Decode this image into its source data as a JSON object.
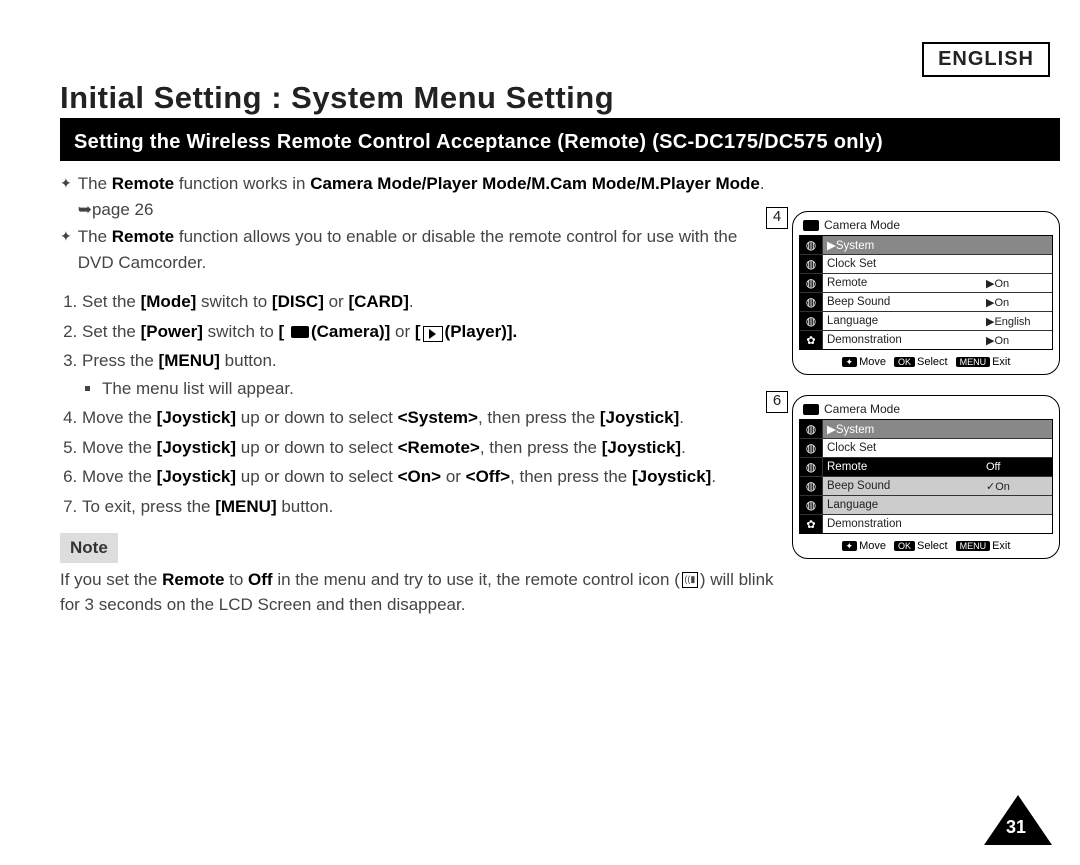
{
  "lang_label": "ENGLISH",
  "main_title": "Initial Setting : System Menu Setting",
  "section_title": "Setting the Wireless Remote Control Acceptance (Remote) (SC-DC175/DC575 only)",
  "bullet1_pre": "The ",
  "bullet1_b1": "Remote",
  "bullet1_mid": " function works in ",
  "bullet1_b2": "Camera Mode/Player Mode/M.Cam Mode/M.Player Mode",
  "bullet1_post": ". ➥page 26",
  "bullet2_pre": "The ",
  "bullet2_b1": "Remote",
  "bullet2_post": " function allows you to enable or disable the remote control for use with the DVD Camcorder.",
  "steps": [
    {
      "pre": "Set the ",
      "b1": "[Mode]",
      "mid": " switch to ",
      "b2": "[DISC]",
      "mid2": " or ",
      "b3": "[CARD]",
      "post": "."
    },
    {
      "pre": "Set the ",
      "b1": "[Power]",
      "mid": " switch to ",
      "b2": "[ ",
      "icon1": "rec",
      "mid2": "(Camera)]",
      "mid3": " or ",
      "b3": "[",
      "icon2": "play",
      "post": "(Player)]."
    },
    {
      "pre": "Press the ",
      "b1": "[MENU]",
      "post": " button."
    },
    {
      "text": "Move the ",
      "b1": "[Joystick]",
      "m1": " up or down to select ",
      "b2": "<System>",
      "m2": ", then press the ",
      "b3": "[Joystick]",
      "post": "."
    },
    {
      "text": "Move the ",
      "b1": "[Joystick]",
      "m1": " up or down to select ",
      "b2": "<Remote>",
      "m2": ", then press the ",
      "b3": "[Joystick]",
      "post": "."
    },
    {
      "text": "Move the ",
      "b1": "[Joystick]",
      "m1": " up or down to select ",
      "b2": "<On>",
      "m2": " or ",
      "b3": "<Off>",
      "m3": ", then press the ",
      "b4": "[Joystick]",
      "post": "."
    },
    {
      "pre": "To exit, press the ",
      "b1": "[MENU]",
      "post": " button."
    }
  ],
  "substep3": "The menu list will appear.",
  "note_label": "Note",
  "note_pre": "If you set the ",
  "note_b1": "Remote",
  "note_mid1": " to ",
  "note_b2": "Off",
  "note_mid2": " in the menu and try to use it, the remote control icon (",
  "note_icon": "remote",
  "note_post": ") will blink for 3 seconds on the LCD Screen and then disappear.",
  "shots": {
    "s4": {
      "num": "4",
      "header": "Camera Mode",
      "rows": [
        {
          "label": "▶System",
          "val": "",
          "cls": "hl"
        },
        {
          "label": "Clock Set",
          "val": ""
        },
        {
          "label": "Remote",
          "val": "▶On"
        },
        {
          "label": "Beep Sound",
          "val": "▶On"
        },
        {
          "label": "Language",
          "val": "▶English"
        },
        {
          "label": "Demonstration",
          "val": "▶On",
          "gear": true
        }
      ],
      "foot": {
        "move": "Move",
        "select": "Select",
        "exit": "Exit"
      }
    },
    "s6": {
      "num": "6",
      "header": "Camera Mode",
      "rows": [
        {
          "label": "▶System",
          "val": "",
          "cls": "hl"
        },
        {
          "label": "Clock Set",
          "val": ""
        },
        {
          "label": "Remote",
          "val": "Off",
          "cls": "sel"
        },
        {
          "label": "Beep Sound",
          "val": "✓On",
          "cls": "lg"
        },
        {
          "label": "Language",
          "val": "",
          "cls": "lg"
        },
        {
          "label": "Demonstration",
          "val": "",
          "gear": true
        }
      ],
      "foot": {
        "move": "Move",
        "select": "Select",
        "exit": "Exit"
      }
    }
  },
  "page_num": "31"
}
